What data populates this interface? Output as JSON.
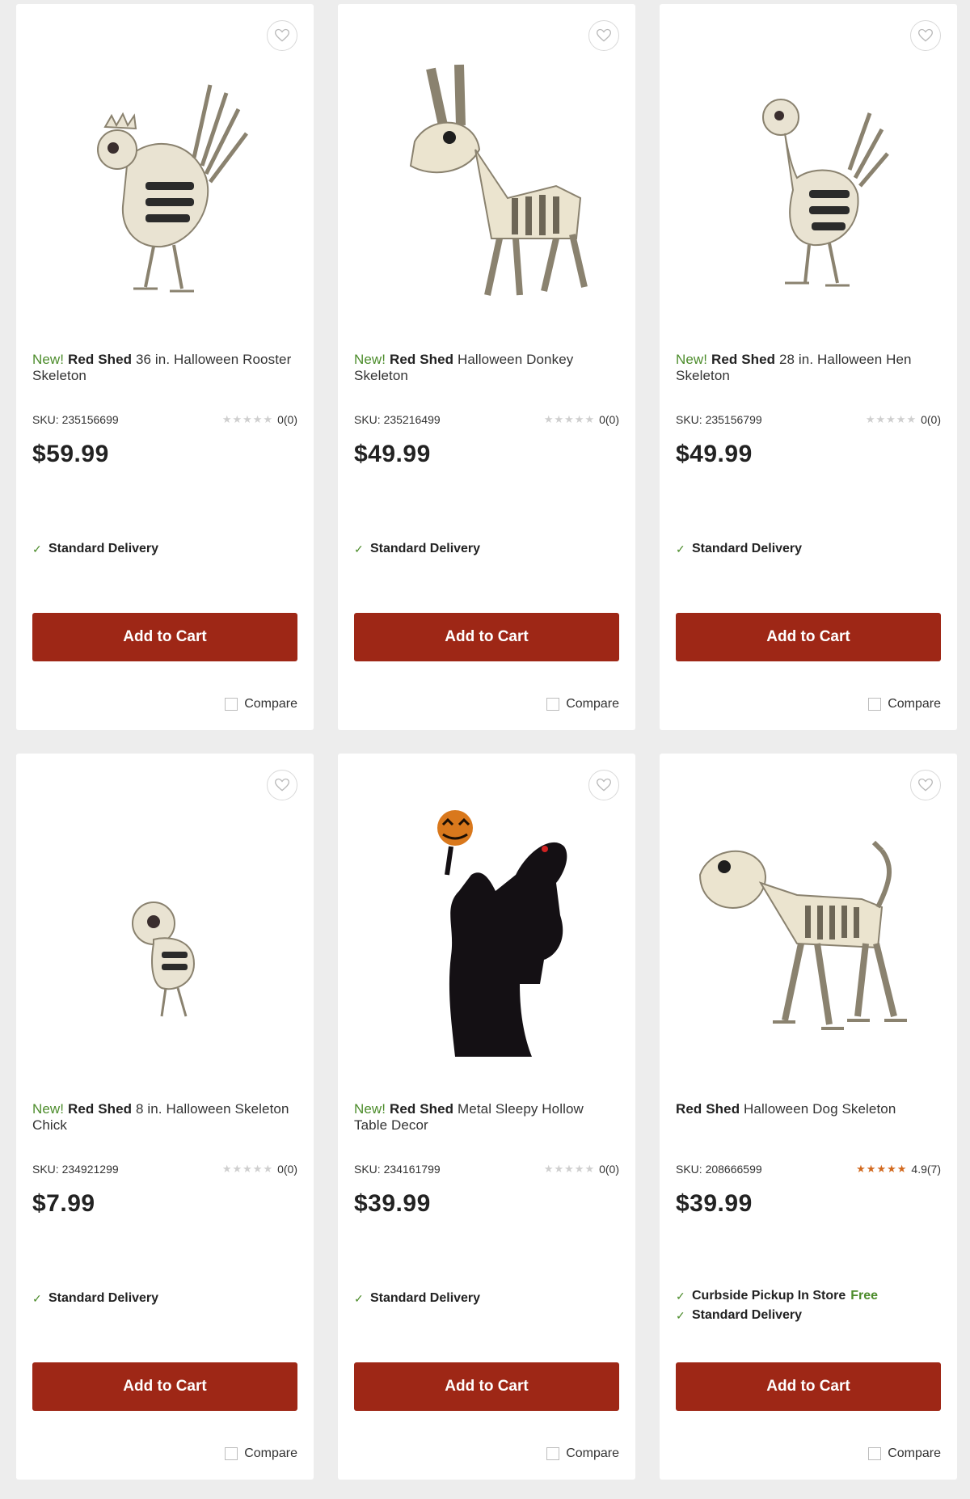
{
  "products": [
    {
      "new_label": "New!",
      "brand": "Red Shed",
      "name": "36 in. Halloween Rooster Skeleton",
      "sku": "SKU: 235156699",
      "rating_stars": 0,
      "rating_count": "0(0)",
      "price": "$59.99",
      "delivery": [
        {
          "label": "Standard Delivery",
          "extra": ""
        }
      ],
      "cart_label": "Add to Cart",
      "compare_label": "Compare",
      "image_icon": "rooster-skeleton-image"
    },
    {
      "new_label": "New!",
      "brand": "Red Shed",
      "name": "Halloween Donkey Skeleton",
      "sku": "SKU: 235216499",
      "rating_stars": 0,
      "rating_count": "0(0)",
      "price": "$49.99",
      "delivery": [
        {
          "label": "Standard Delivery",
          "extra": ""
        }
      ],
      "cart_label": "Add to Cart",
      "compare_label": "Compare",
      "image_icon": "donkey-skeleton-image"
    },
    {
      "new_label": "New!",
      "brand": "Red Shed",
      "name": "28 in. Halloween Hen Skeleton",
      "sku": "SKU: 235156799",
      "rating_stars": 0,
      "rating_count": "0(0)",
      "price": "$49.99",
      "delivery": [
        {
          "label": "Standard Delivery",
          "extra": ""
        }
      ],
      "cart_label": "Add to Cart",
      "compare_label": "Compare",
      "image_icon": "hen-skeleton-image"
    },
    {
      "new_label": "New!",
      "brand": "Red Shed",
      "name": "8 in. Halloween Skeleton Chick",
      "sku": "SKU: 234921299",
      "rating_stars": 0,
      "rating_count": "0(0)",
      "price": "$7.99",
      "delivery": [
        {
          "label": "Standard Delivery",
          "extra": ""
        }
      ],
      "cart_label": "Add to Cart",
      "compare_label": "Compare",
      "image_icon": "chick-skeleton-image"
    },
    {
      "new_label": "New!",
      "brand": "Red Shed",
      "name": "Metal Sleepy Hollow Table Decor",
      "sku": "SKU: 234161799",
      "rating_stars": 0,
      "rating_count": "0(0)",
      "price": "$39.99",
      "delivery": [
        {
          "label": "Standard Delivery",
          "extra": ""
        }
      ],
      "cart_label": "Add to Cart",
      "compare_label": "Compare",
      "image_icon": "headless-horseman-image"
    },
    {
      "new_label": "",
      "brand": "Red Shed",
      "name": "Halloween Dog Skeleton",
      "sku": "SKU: 208666599",
      "rating_stars": 5,
      "rating_count": "4.9(7)",
      "price": "$39.99",
      "delivery": [
        {
          "label": "Curbside Pickup In Store",
          "extra": "Free"
        },
        {
          "label": "Standard Delivery",
          "extra": ""
        }
      ],
      "cart_label": "Add to Cart",
      "compare_label": "Compare",
      "image_icon": "dog-skeleton-image"
    }
  ],
  "colors": {
    "cart_button": "#9e2716",
    "new_label": "#4c8c2b",
    "rating_star": "#d2691e",
    "background": "#ededed"
  }
}
